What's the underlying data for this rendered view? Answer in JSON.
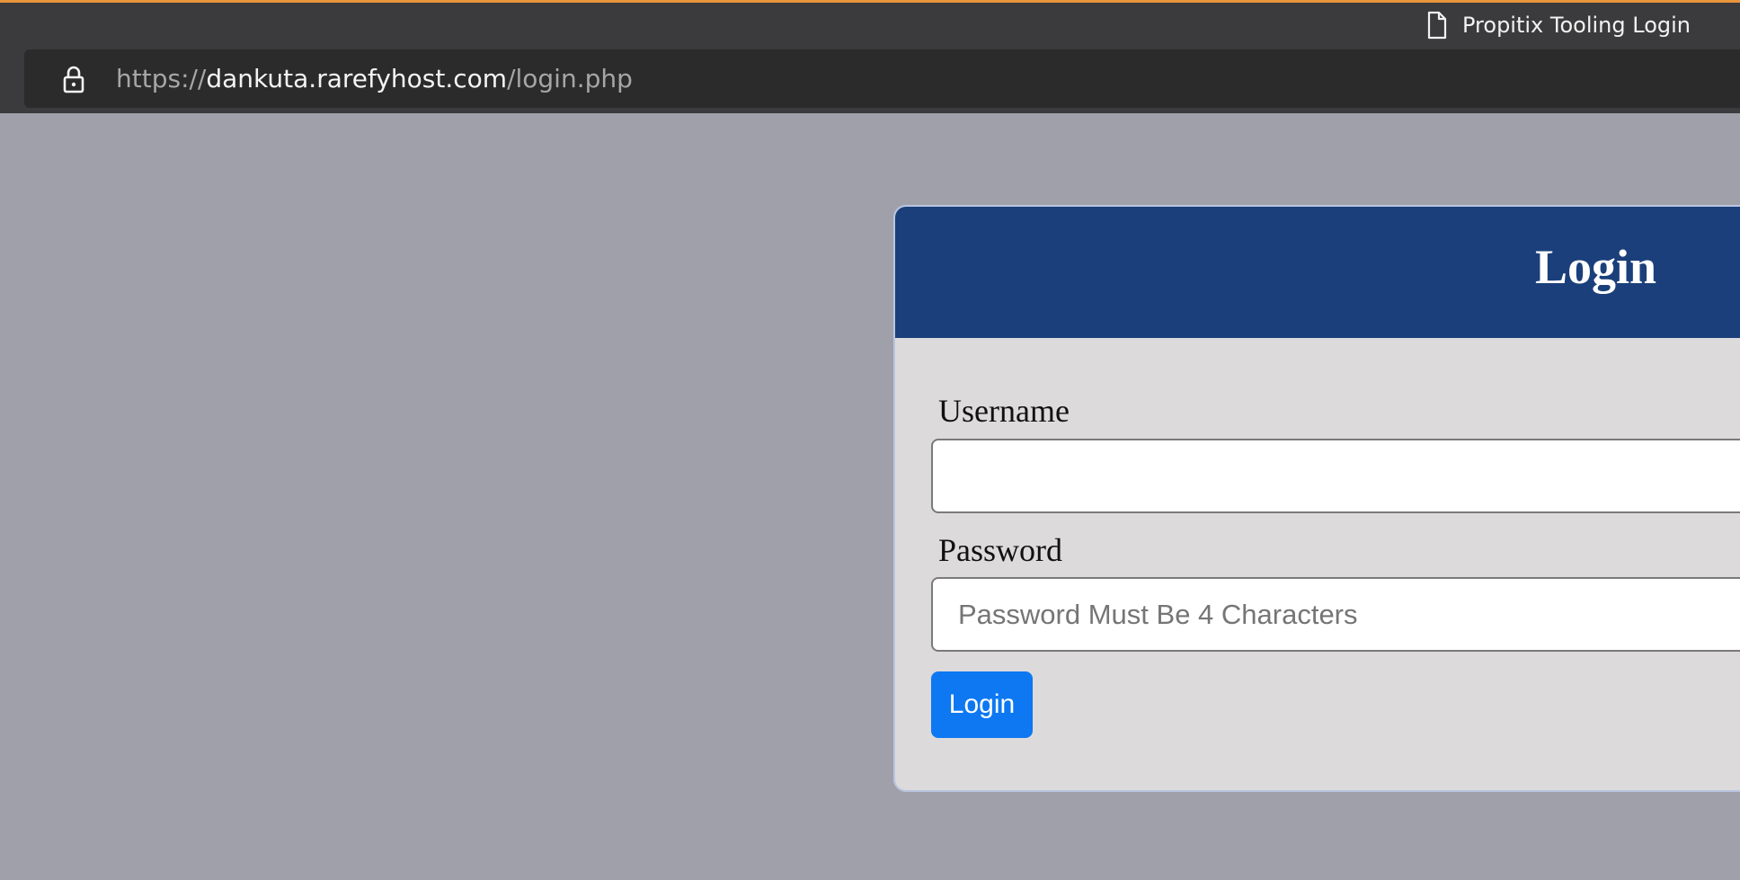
{
  "browser": {
    "tab_title": "Propitix Tooling Login",
    "url_scheme": "https://",
    "url_host": "dankuta.rarefyhost.com",
    "url_path": "/login.php",
    "icons": {
      "tab": "document-icon",
      "security": "lock-icon"
    },
    "colors": {
      "accent_line": "#e8953b"
    }
  },
  "login_card": {
    "title": "Login",
    "username_label": "Username",
    "username_value": "",
    "username_placeholder": "",
    "password_label": "Password",
    "password_value": "",
    "password_placeholder": "Password Must Be 4 Characters",
    "submit_label": "Login",
    "colors": {
      "header": "#1b3f7a",
      "button": "#0d78f2",
      "background": "#a0a0ab"
    }
  }
}
